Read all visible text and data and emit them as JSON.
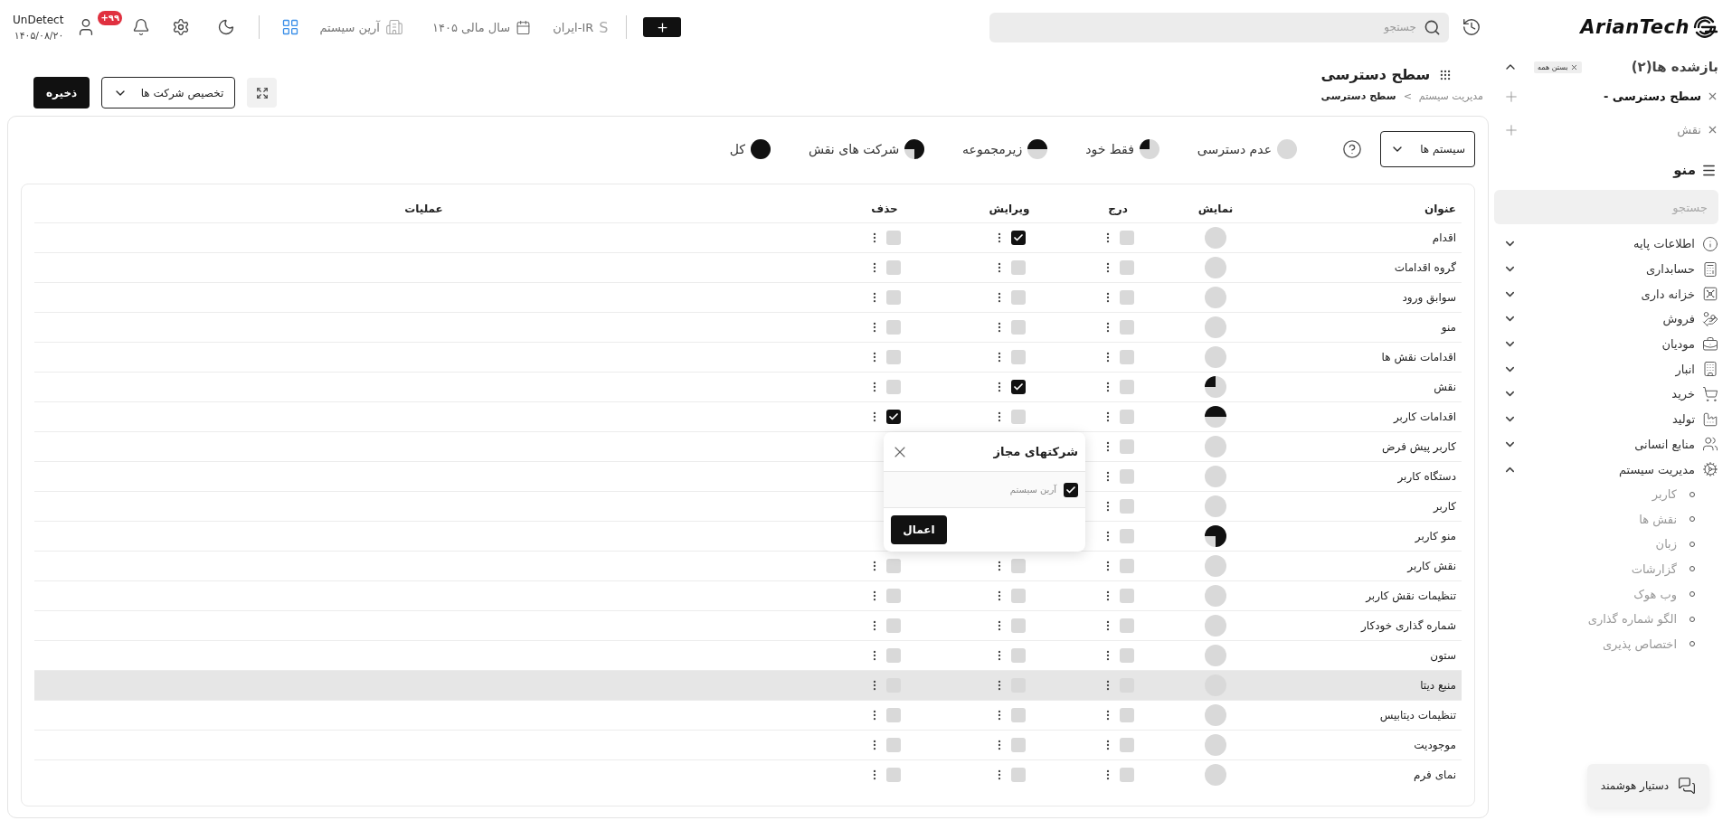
{
  "topbar": {
    "user": {
      "name": "UnDetect",
      "date": "۱۴۰۵/۰۸/۲۰"
    },
    "notifications_badge": "+۹۹",
    "company": "آرین سیستم",
    "fiscal_year": "سال مالی ۱۴۰۵",
    "locale_symbol": "S",
    "locale": "ایران-IR",
    "search": {
      "placeholder": "جستجو"
    }
  },
  "logo": {
    "text": "ArianTech"
  },
  "page": {
    "title": "سطح دسترسی",
    "breadcrumb": [
      "مدیریت سیستم",
      "سطح دسترسی"
    ],
    "breadcrumb_separator": ">",
    "save_button": "ذخیره",
    "assign_dropdown": "تخصیص شرکت ها"
  },
  "filter": {
    "system_dropdown": "سیستم ها"
  },
  "legend": [
    {
      "kind": "none",
      "label": "عدم دسترسی"
    },
    {
      "kind": "own",
      "label": "فقط خود"
    },
    {
      "kind": "sub",
      "label": "زیرمجموعه"
    },
    {
      "kind": "role_companies",
      "label": "شرکت های نقش"
    },
    {
      "kind": "all",
      "label": "کل"
    }
  ],
  "table": {
    "columns": [
      "عنوان",
      "نمایش",
      "درج",
      "ویرایش",
      "حذف",
      "عملیات"
    ],
    "rows": [
      {
        "title": "اقدام",
        "access": {
          "kind": "none"
        },
        "insert": false,
        "edit": true,
        "delete": false,
        "selected": false
      },
      {
        "title": "گروه اقدامات",
        "access": {
          "kind": "none"
        },
        "insert": false,
        "edit": false,
        "delete": false,
        "selected": false
      },
      {
        "title": "سوابق ورود",
        "access": {
          "kind": "none"
        },
        "insert": false,
        "edit": false,
        "delete": false,
        "selected": false
      },
      {
        "title": "منو",
        "access": {
          "kind": "none"
        },
        "insert": false,
        "edit": false,
        "delete": false,
        "selected": false
      },
      {
        "title": "اقدامات نقش ها",
        "access": {
          "kind": "none"
        },
        "insert": false,
        "edit": false,
        "delete": false,
        "selected": false
      },
      {
        "title": "نقش",
        "access": {
          "kind": "own"
        },
        "insert": false,
        "edit": true,
        "delete": false,
        "selected": false
      },
      {
        "title": "اقدامات کاربر",
        "access": {
          "kind": "sub"
        },
        "insert": false,
        "edit": false,
        "delete": true,
        "selected": false
      },
      {
        "title": "کاربر پیش فرض",
        "access": {
          "kind": "none"
        },
        "insert": false,
        "edit": null,
        "delete": null,
        "selected": false
      },
      {
        "title": "دستگاه کاربر",
        "access": {
          "kind": "none"
        },
        "insert": false,
        "edit": null,
        "delete": null,
        "selected": false
      },
      {
        "title": "کاربر",
        "access": {
          "kind": "none"
        },
        "insert": false,
        "edit": null,
        "delete": null,
        "selected": false
      },
      {
        "title": "منو کاربر",
        "access": {
          "kind": "role_companies"
        },
        "insert": false,
        "edit": null,
        "delete": null,
        "selected": false
      },
      {
        "title": "نقش کاربر",
        "access": {
          "kind": "none"
        },
        "insert": false,
        "edit": false,
        "delete": false,
        "selected": false
      },
      {
        "title": "تنظیمات نقش کاربر",
        "access": {
          "kind": "none"
        },
        "insert": false,
        "edit": false,
        "delete": false,
        "selected": false
      },
      {
        "title": "شماره گذاری خودکار",
        "access": {
          "kind": "none"
        },
        "insert": false,
        "edit": false,
        "delete": false,
        "selected": false
      },
      {
        "title": "ستون",
        "access": {
          "kind": "none"
        },
        "insert": false,
        "edit": false,
        "delete": false,
        "selected": false
      },
      {
        "title": "منبع دیتا",
        "access": {
          "kind": "none"
        },
        "insert": false,
        "edit": false,
        "delete": false,
        "selected": true
      },
      {
        "title": "تنظیمات دیتابیس",
        "access": {
          "kind": "none"
        },
        "insert": false,
        "edit": false,
        "delete": false,
        "selected": false
      },
      {
        "title": "موجودیت",
        "access": {
          "kind": "none"
        },
        "insert": false,
        "edit": false,
        "delete": false,
        "selected": false
      },
      {
        "title": "نمای فرم",
        "access": {
          "kind": "none"
        },
        "insert": false,
        "edit": false,
        "delete": false,
        "selected": false
      }
    ]
  },
  "popup": {
    "title": "شرکتهای مجاز",
    "options": [
      {
        "label": "آرین سیستم",
        "checked": true
      }
    ],
    "apply_button": "اعمال"
  },
  "sidebar": {
    "recent_title": "بازشده ها(۲)",
    "close_all": "بستن همه",
    "recent_tabs": [
      {
        "label": "سطح دسترسی -",
        "selected": true
      },
      {
        "label": "نقش",
        "selected": false
      }
    ],
    "menu_title": "منو",
    "search": {
      "placeholder": "جستجو"
    },
    "menu": [
      {
        "label": "اطلاعات پایه",
        "expanded": false
      },
      {
        "label": "حسابداری",
        "expanded": false
      },
      {
        "label": "خزانه داری",
        "expanded": false
      },
      {
        "label": "فروش",
        "expanded": false
      },
      {
        "label": "مودیان",
        "expanded": false
      },
      {
        "label": "انبار",
        "expanded": false
      },
      {
        "label": "خرید",
        "expanded": false
      },
      {
        "label": "تولید",
        "expanded": false
      },
      {
        "label": "منابع انسانی",
        "expanded": false
      },
      {
        "label": "مدیریت سیستم",
        "expanded": true,
        "children": [
          "کاربر",
          "نقش ها",
          "زبان",
          "گزارشات",
          "وب هوک",
          "الگو شماره گذاری",
          "اختصاص پذیری"
        ]
      }
    ]
  },
  "assistant_button": "دستیار هوشمند"
}
